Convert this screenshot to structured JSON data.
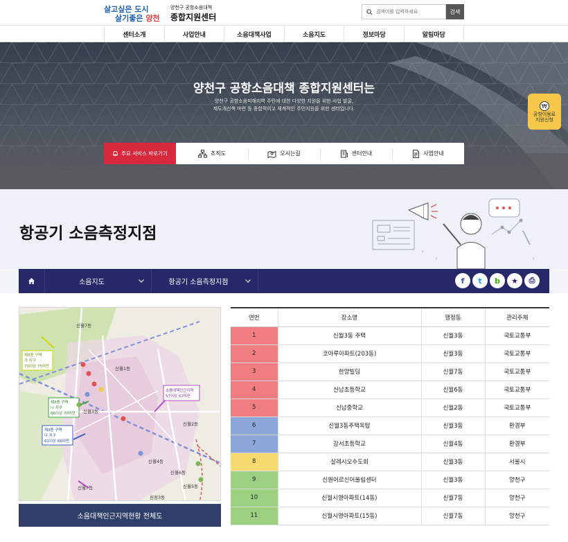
{
  "header": {
    "slogan_line1": "살고싶은 도시",
    "slogan_line2_a": "살기좋은 ",
    "slogan_line2_b": "양천",
    "center_line1": "양천구 공항소음대책",
    "center_line2": "종합지원센터",
    "search_placeholder": "검색어를 입력하세요",
    "search_button": "검색"
  },
  "nav": [
    "센터소개",
    "사업안내",
    "소음대책사업",
    "소음지도",
    "정보마당",
    "알림마당"
  ],
  "hero": {
    "title": "양천구 공항소음대책 종합지원센터는",
    "sub1": "양천구 공항소음피해지역 주민에 대한 다양한 지원을 위한 사업 발굴,",
    "sub2": "제도개선책 마련 등 종합적이고 체계적인 주민지원을 위한 센터입니다.",
    "quick_main": "주요 서비스 바로가기",
    "quick_items": [
      "조직도",
      "오시는길",
      "센터안내",
      "사업안내"
    ],
    "side_badge_line1": "공항이용료",
    "side_badge_line2": "지원신청"
  },
  "page_title": "항공기 소음측정지점",
  "breadcrumb": {
    "level1": "소음지도",
    "level2": "항공기 소음측정지점",
    "share_labels": [
      "f",
      "t",
      "b",
      "★",
      "⎙"
    ]
  },
  "map": {
    "button": "소음대책인근지역현황 전체도",
    "labels": {
      "zone1": "제3종 구역\n가 지구\n70이상 75미만",
      "zone2": "제3종 구역\n나 지구\n66이상 70미만",
      "zone3": "제3종 구역\n다 지구\n61이상 66미만",
      "zone4": "소음대책인근지역\n57이상 61미만",
      "d1": "신월1동",
      "d2": "신월3동",
      "d3": "신월2동",
      "d4": "신월4동",
      "d5": "신월5동",
      "d6": "신월6동",
      "d7": "신월7동",
      "d8": "신정3동"
    }
  },
  "table": {
    "headers": [
      "연번",
      "장소명",
      "행정동",
      "관리주체"
    ],
    "rows": [
      {
        "no": "1",
        "place": "신월3동 주택",
        "dong": "신월3동",
        "owner": "국토교통부",
        "color": "red"
      },
      {
        "no": "2",
        "place": "코아루아파트(203동)",
        "dong": "신월3동",
        "owner": "국토교통부",
        "color": "red"
      },
      {
        "no": "3",
        "place": "한양빌딩",
        "dong": "신월7동",
        "owner": "국토교통부",
        "color": "red"
      },
      {
        "no": "4",
        "place": "신남초등학교",
        "dong": "신월6동",
        "owner": "국토교통부",
        "color": "red"
      },
      {
        "no": "5",
        "place": "신남중학교",
        "dong": "신월2동",
        "owner": "국토교통부",
        "color": "red"
      },
      {
        "no": "6",
        "place": "신월3동주택옥탑",
        "dong": "신월3동",
        "owner": "환경부",
        "color": "blue"
      },
      {
        "no": "7",
        "place": "강서초등학교",
        "dong": "신월4동",
        "owner": "환경부",
        "color": "blue"
      },
      {
        "no": "8",
        "place": "살레시오수도회",
        "dong": "신월3동",
        "owner": "서울시",
        "color": "yellow"
      },
      {
        "no": "9",
        "place": "신원어르신어울림센터",
        "dong": "신월3동",
        "owner": "양천구",
        "color": "green"
      },
      {
        "no": "10",
        "place": "신월시영아파트(14동)",
        "dong": "신월7동",
        "owner": "양천구",
        "color": "green"
      },
      {
        "no": "11",
        "place": "신월시영아파트(15동)",
        "dong": "신월7동",
        "owner": "양천구",
        "color": "green"
      }
    ]
  },
  "colors": {
    "nav_dark": "#27286a",
    "accent_red": "#d7283d",
    "row_red": "#f07d80",
    "row_blue": "#8ba6d8",
    "row_yellow": "#f6da6e",
    "row_green": "#9ccf7f"
  }
}
